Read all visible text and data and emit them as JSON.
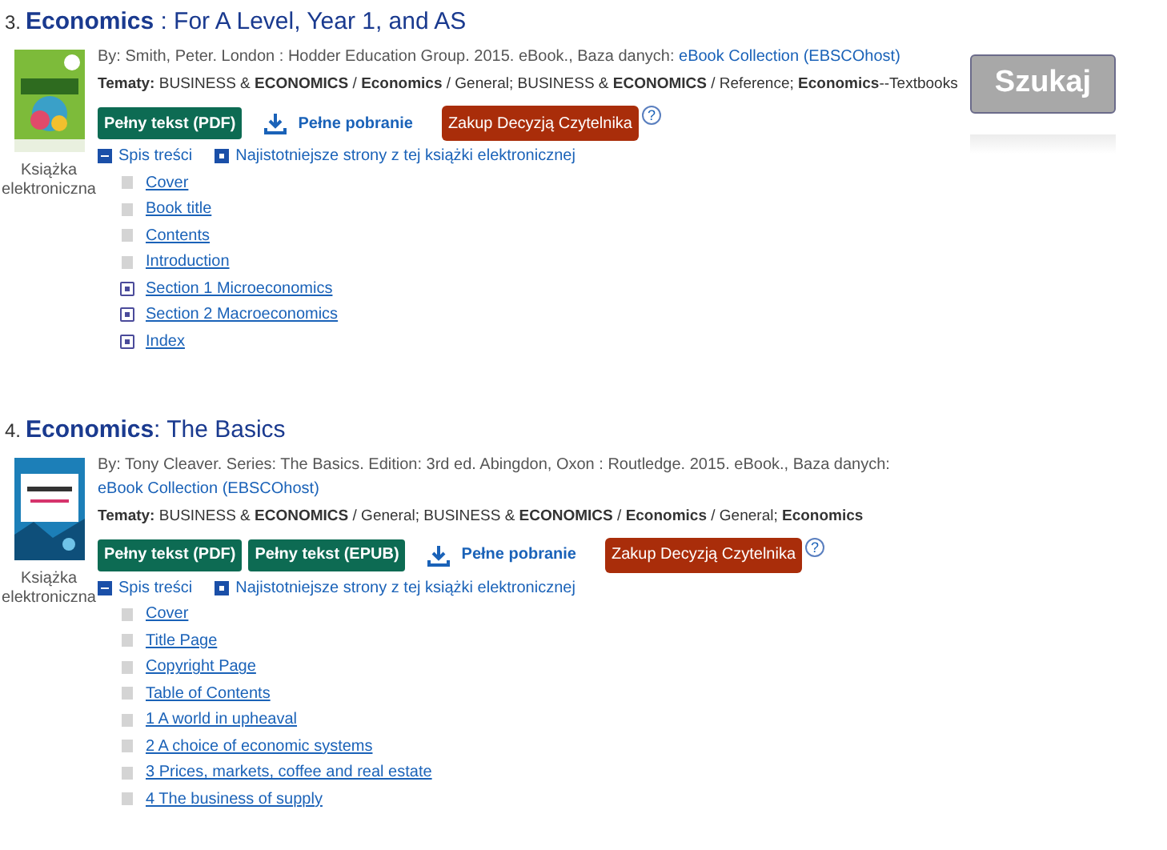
{
  "search_button": {
    "label": "Szukaj",
    "disabled": true
  },
  "results": [
    {
      "number": "3.",
      "title": "**Economics** : For A Level, Year 1, and AS",
      "format": "Książka elektroniczna",
      "byline": "By: Smith, Peter. London : Hodder Education Group. 2015. eBook., Baza danych:",
      "database_link": "eBook Collection (EBSCOhost)",
      "subjects_label": "Tematy:",
      "subjects": "BUSINESS & **ECONOMICS** / **Economics** / General; BUSINESS & **ECONOMICS** / Reference; **Economics**--Textbooks",
      "actions": [
        {
          "kind": "fulltext",
          "label": "Pełny tekst (PDF)"
        },
        {
          "kind": "download",
          "label": "Pełne pobranie"
        },
        {
          "kind": "purchase",
          "label": "Zakup Decyzją Czytelnika"
        },
        {
          "kind": "help",
          "label": "?"
        }
      ],
      "toc_toggle": {
        "label": "Spis treści",
        "expanded": true
      },
      "pages_link": "Najistotniejsze strony z tej książki elektronicznej",
      "toc_items": [
        {
          "kind": "leaf",
          "label": "Cover"
        },
        {
          "kind": "leaf",
          "label": "Book title"
        },
        {
          "kind": "leaf",
          "label": "Contents"
        },
        {
          "kind": "leaf",
          "label": "Introduction"
        },
        {
          "kind": "section",
          "label": "Section 1 Microeconomics"
        },
        {
          "kind": "section",
          "label": "Section 2 Macroeconomics"
        },
        {
          "kind": "section",
          "label": "Index"
        }
      ]
    },
    {
      "number": "4.",
      "title": "**Economics**: The Basics",
      "format": "Książka elektroniczna",
      "byline": "By: Tony Cleaver. Series: The Basics. Edition: 3rd ed. Abingdon, Oxon : Routledge. 2015. eBook., Baza danych:",
      "database_link": "eBook Collection (EBSCOhost)",
      "subjects_label": "Tematy:",
      "subjects": "BUSINESS & **ECONOMICS** / General; BUSINESS & **ECONOMICS** / **Economics** / General; **Economics**",
      "actions": [
        {
          "kind": "fulltext",
          "label": "Pełny tekst (PDF)"
        },
        {
          "kind": "fulltext",
          "label": "Pełny tekst (EPUB)"
        },
        {
          "kind": "download",
          "label": "Pełne pobranie"
        },
        {
          "kind": "purchase",
          "label": "Zakup Decyzją Czytelnika"
        },
        {
          "kind": "help",
          "label": "?"
        }
      ],
      "toc_toggle": {
        "label": "Spis treści",
        "expanded": true
      },
      "pages_link": "Najistotniejsze strony z tej książki elektronicznej",
      "toc_items": [
        {
          "kind": "leaf",
          "label": "Cover"
        },
        {
          "kind": "leaf",
          "label": "Title Page"
        },
        {
          "kind": "leaf",
          "label": "Copyright Page"
        },
        {
          "kind": "leaf",
          "label": "Table of Contents"
        },
        {
          "kind": "leaf",
          "label": "1 A world in upheaval"
        },
        {
          "kind": "leaf",
          "label": "2 A choice of economic systems"
        },
        {
          "kind": "leaf",
          "label": "3 Prices, markets, coffee and real estate"
        },
        {
          "kind": "leaf",
          "label": "4 The business of supply"
        }
      ]
    }
  ]
}
